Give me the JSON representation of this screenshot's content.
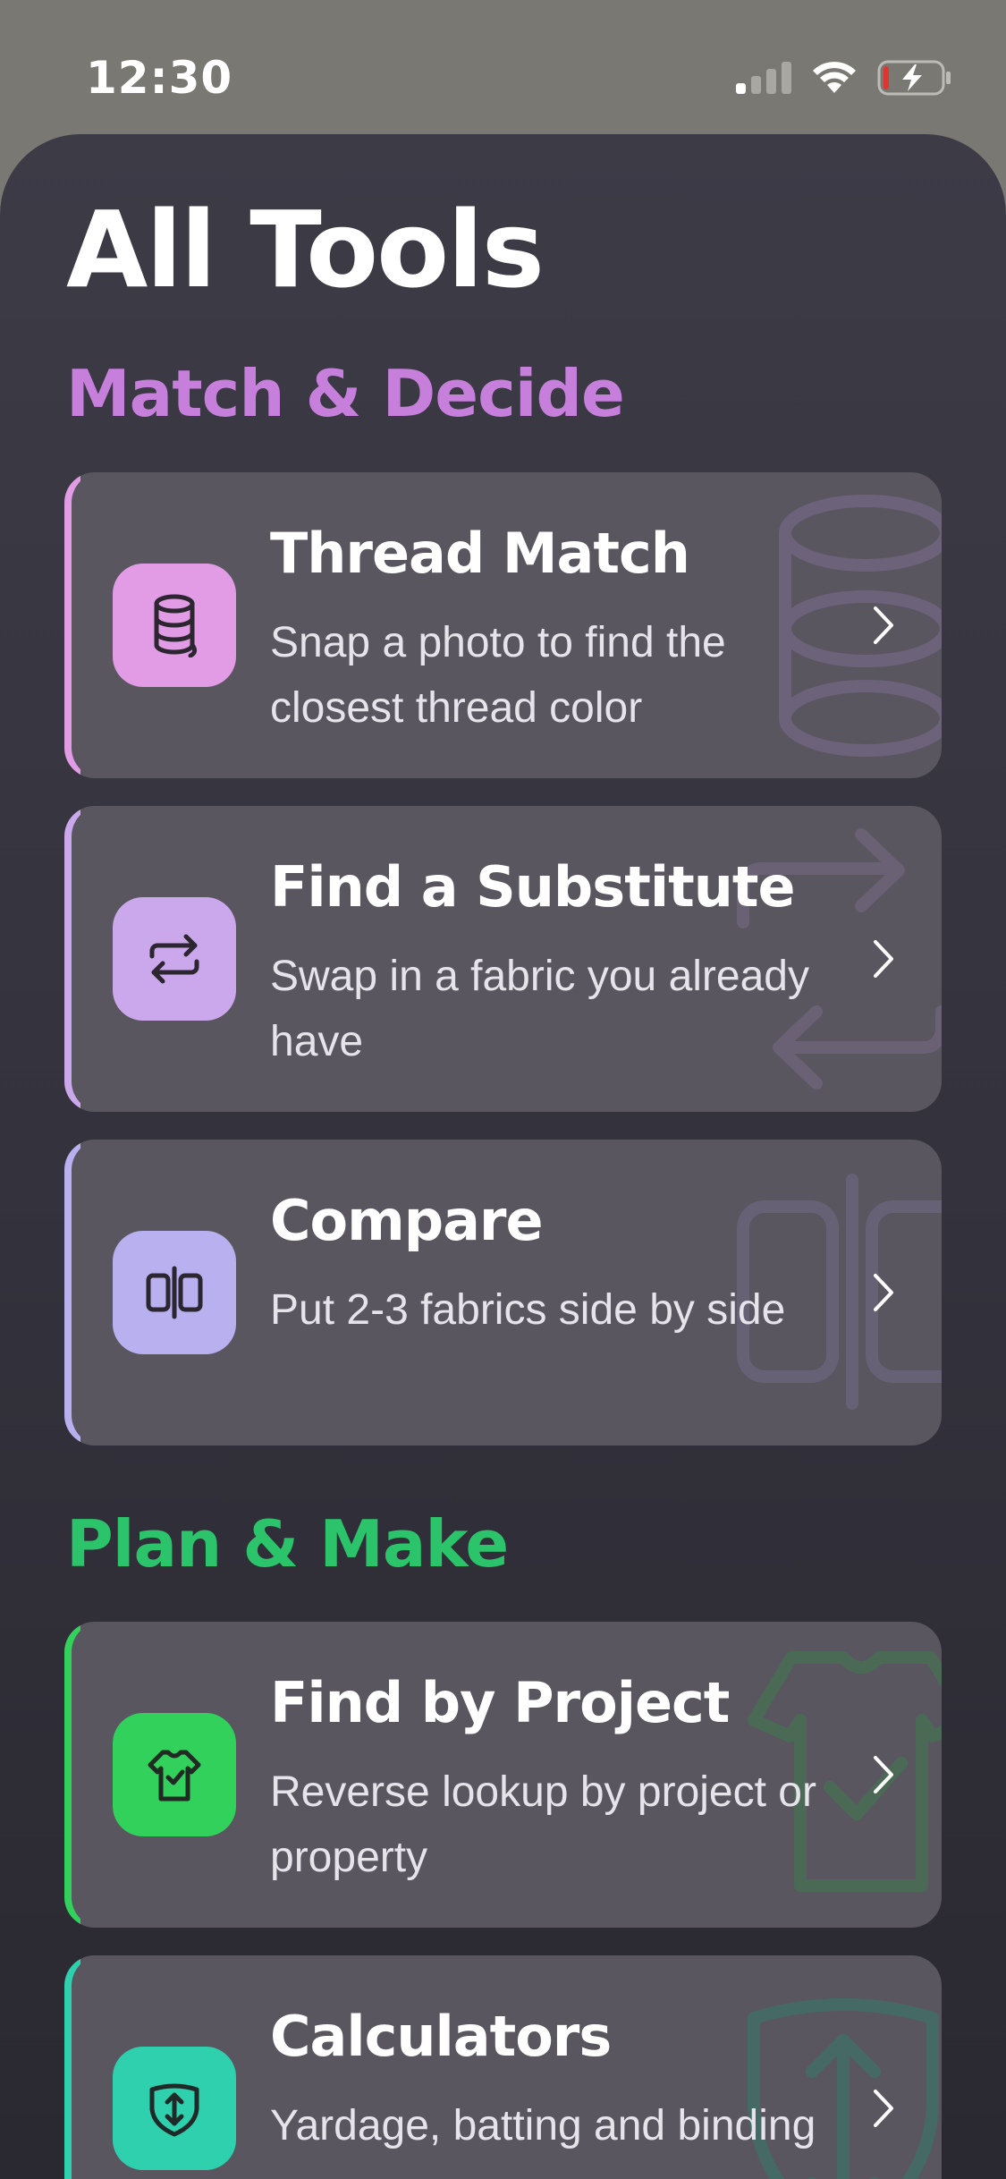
{
  "status_bar": {
    "time": "12:30",
    "icons": [
      "cellular-signal-icon",
      "wifi-icon",
      "battery-charging-icon"
    ]
  },
  "page": {
    "title": "All Tools"
  },
  "sections": [
    {
      "title": "Match & Decide",
      "color": "#c77fdc",
      "cards": [
        {
          "title": "Thread Match",
          "description": "Snap a photo to find the closest thread color",
          "icon": "thread-spool-icon",
          "accent": "#e29ce6"
        },
        {
          "title": "Find a Substitute",
          "description": "Swap in a fabric you already have",
          "icon": "swap-arrows-icon",
          "accent": "#cba7ec"
        },
        {
          "title": "Compare",
          "description": "Put 2-3 fabrics side by side",
          "icon": "compare-panels-icon",
          "accent": "#b9b0f0"
        }
      ]
    },
    {
      "title": "Plan & Make",
      "color": "#2bc46a",
      "cards": [
        {
          "title": "Find by Project",
          "description": "Reverse lookup by project or property",
          "icon": "tshirt-icon",
          "accent": "#31d15c"
        },
        {
          "title": "Calculators",
          "description": "Yardage, batting and binding",
          "icon": "calculator-shield-icon",
          "accent": "#2fd0ad"
        }
      ]
    }
  ]
}
